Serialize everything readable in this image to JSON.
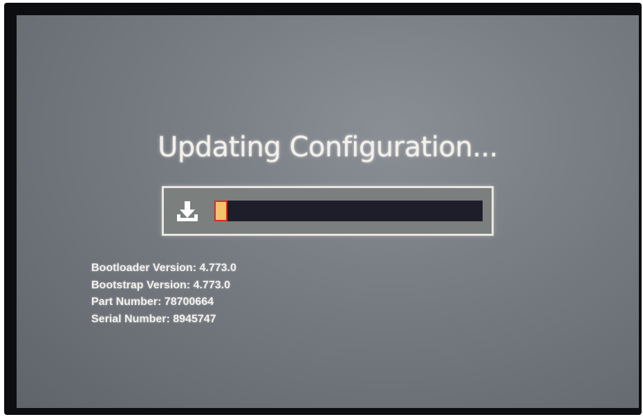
{
  "screen": {
    "title": "Updating Configuration...",
    "progress": {
      "icon": "download-icon",
      "fraction": 0.05
    },
    "info": [
      "Bootloader Version: 4.773.0",
      "Bootstrap Version: 4.773.0",
      "Part Number: 78700664",
      "Serial Number: 8945747"
    ]
  },
  "colors": {
    "screen_background": "#7a7f85",
    "text": "#f4f1ea",
    "track": "#1e1d2a",
    "fill": "#f0c46a",
    "fill_border": "#d52a2a"
  }
}
